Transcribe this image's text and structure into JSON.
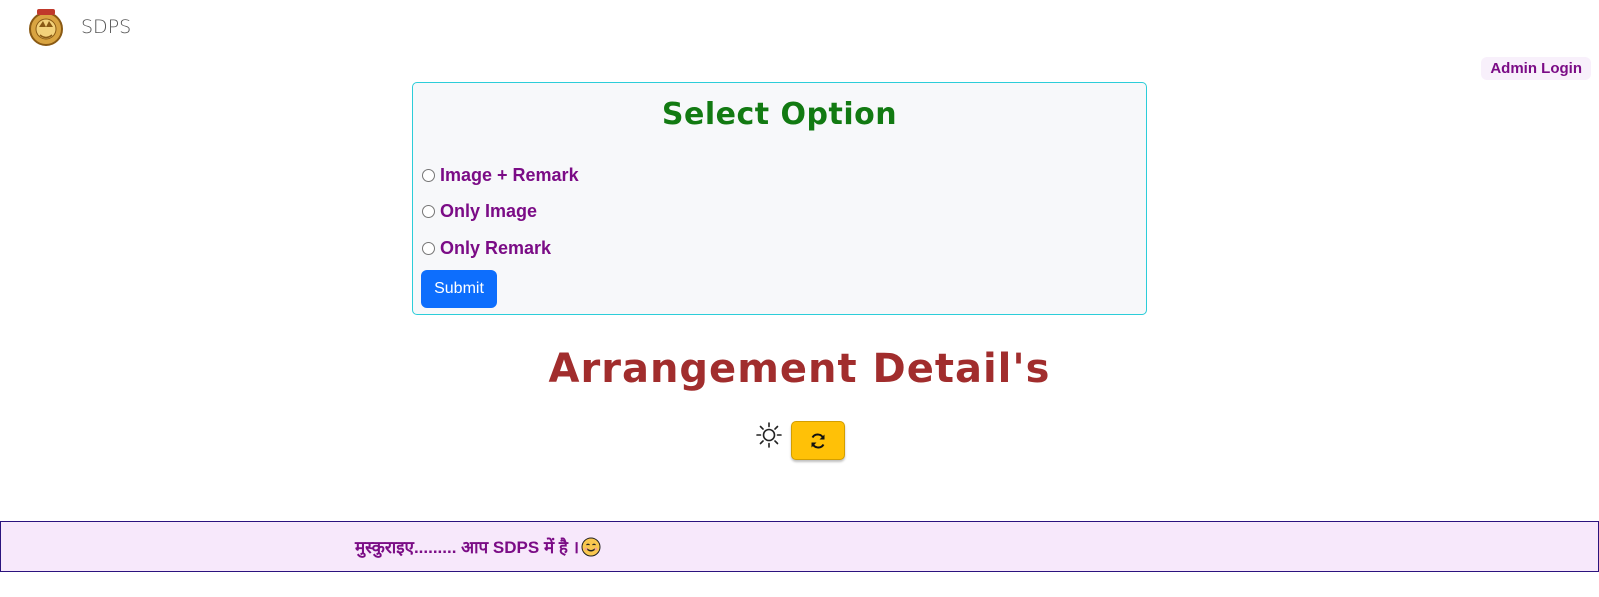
{
  "navbar": {
    "brand": "SDPS",
    "logo_icon": "emblem-logo-icon"
  },
  "admin_login": "Admin Login",
  "option_card": {
    "title": "Select Option",
    "options": [
      {
        "label": "Image + Remark",
        "selected": false
      },
      {
        "label": "Only Image",
        "selected": false
      },
      {
        "label": "Only Remark",
        "selected": false
      }
    ],
    "submit_label": "Submit"
  },
  "arrangement": {
    "title": "Arrangement Detail's",
    "theme_icon": "sun-icon",
    "refresh_icon": "refresh-icon"
  },
  "footer": {
    "message": "मुस्कुराइए......... आप SDPS में है ।",
    "emoji_icon": "smiley-icon"
  },
  "colors": {
    "purple": "#7b0c86",
    "green_title": "#127a12",
    "red_title": "#a12d2d",
    "primary": "#0d6efd",
    "warning": "#ffc107",
    "cyan_border": "#2ccdd9",
    "footer_bg": "#f7e8fb"
  }
}
